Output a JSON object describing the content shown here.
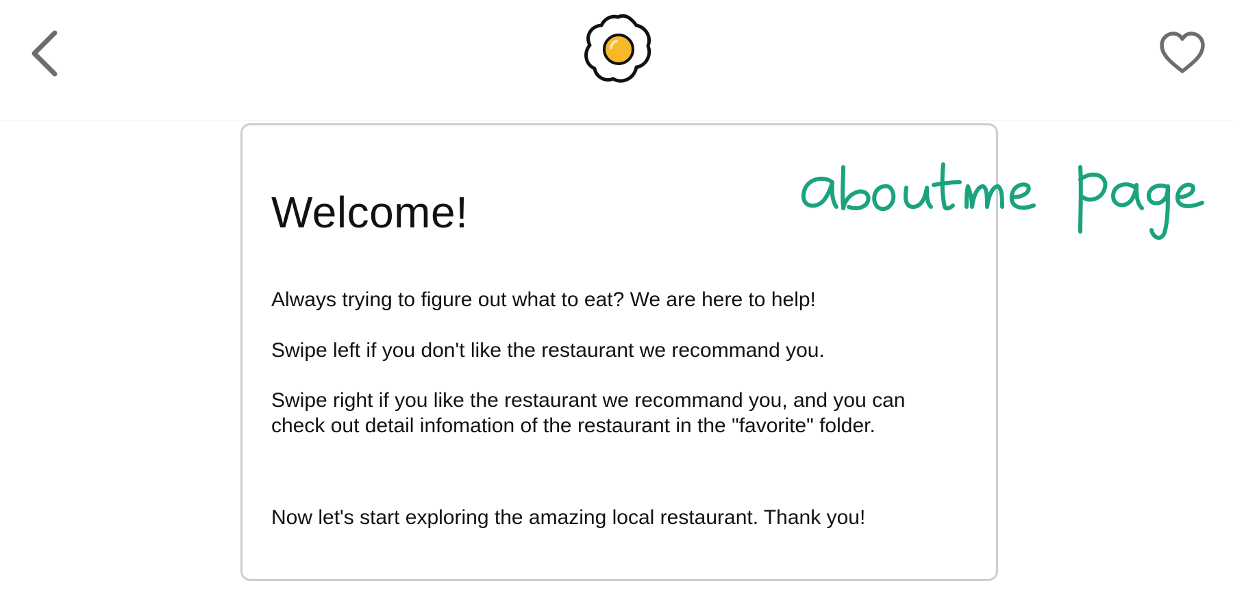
{
  "header": {
    "back_icon": "chevron-left-icon",
    "logo_icon": "fried-egg-logo",
    "favorite_icon": "heart-outline-icon"
  },
  "card": {
    "title": "Welcome!",
    "paragraphs": [
      "Always trying to figure out what to eat? We are here to help!",
      "Swipe left if you don't like the restaurant we recommand you.",
      "Swipe right if you like the restaurant we recommand you, and you can check out detail infomation of the restaurant in the \"favorite\" folder.",
      "Now let's start exploring the amazing local restaurant. Thank you!"
    ]
  },
  "annotation": {
    "text": "about me page",
    "color": "#1aa37e"
  },
  "colors": {
    "icon_gray": "#6d6d6d",
    "card_border": "#cdcdcd",
    "egg_yolk": "#f7b928",
    "text": "#111111"
  }
}
